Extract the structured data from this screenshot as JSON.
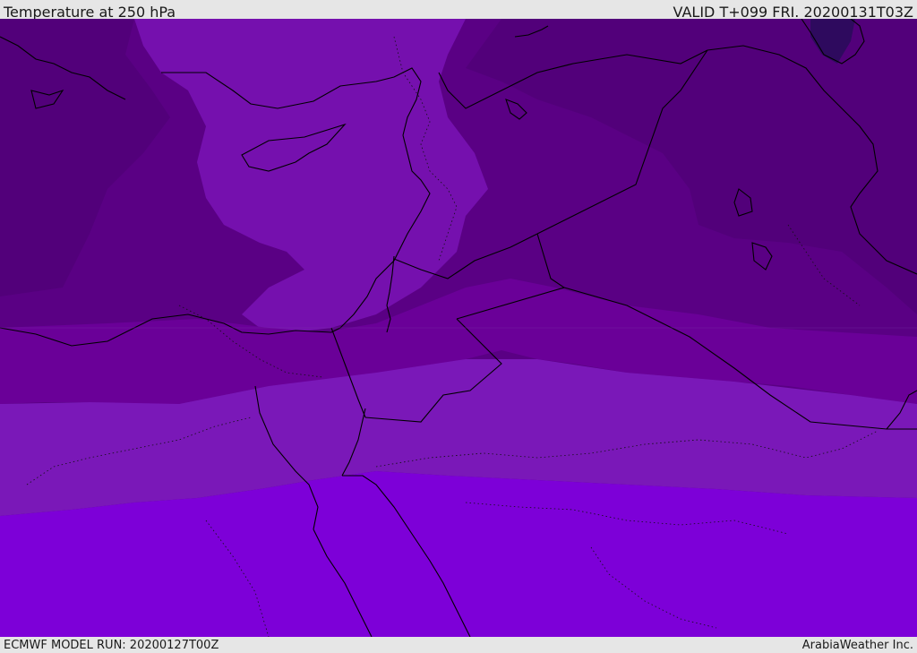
{
  "header": {
    "title": "Temperature at 250 hPa",
    "valid": "VALID T+099 FRI. 20200131T03Z"
  },
  "footer": {
    "model_run": "ECMWF MODEL RUN: 20200127T00Z",
    "credit": "ArabiaWeather Inc."
  },
  "colors": {
    "band_darkest": "#2e0a5e",
    "band_dark": "#55007f",
    "band_mid": "#63008f",
    "band_light": "#7510ae",
    "band_lighter": "#7a18b8",
    "band_bright": "#7d00d8",
    "coastline": "#000000"
  }
}
